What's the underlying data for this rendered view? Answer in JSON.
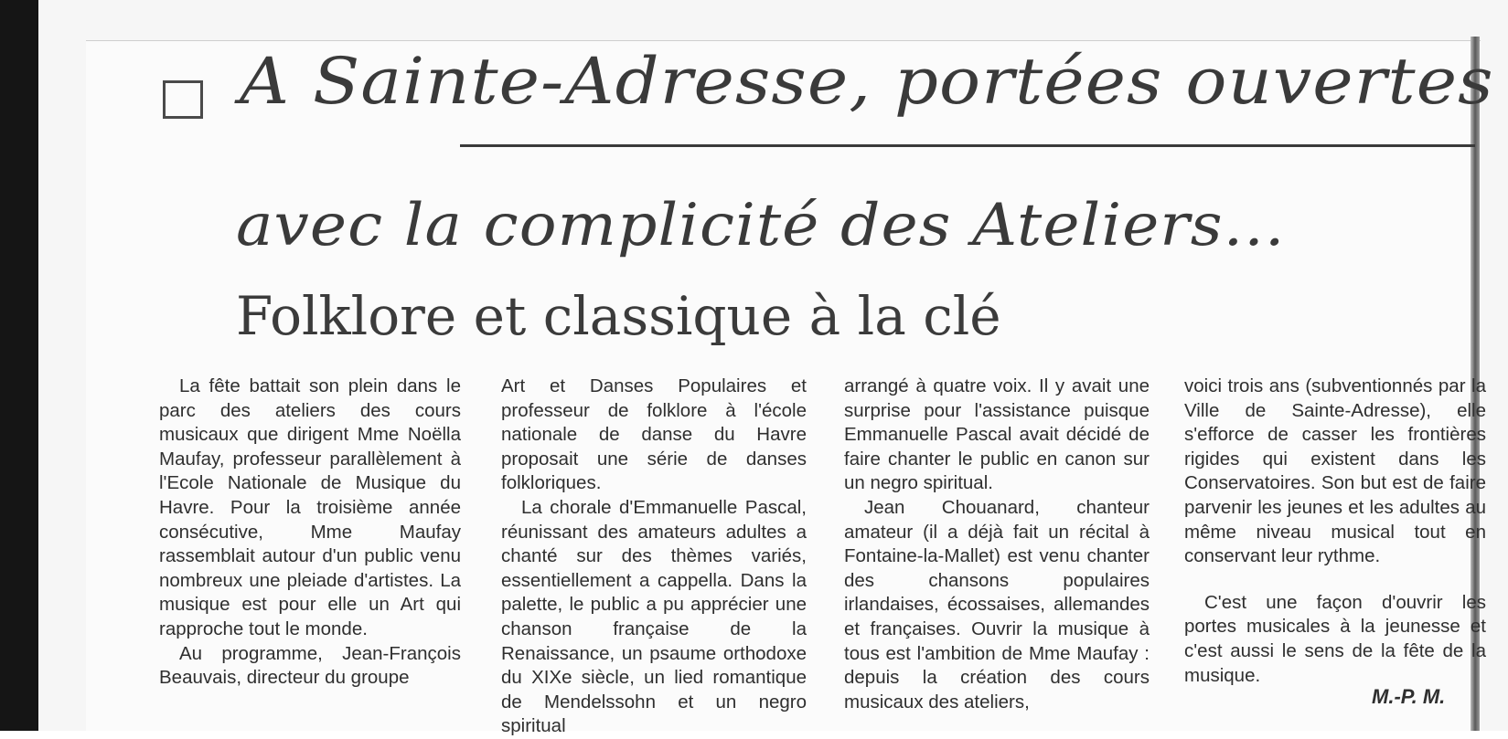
{
  "article": {
    "title_line1": "A Sainte-Adresse, portées ouvertes",
    "title_line2": "avec la complicité des Ateliers...",
    "subtitle": "Folklore et classique à la clé",
    "col1": {
      "p1": "La fête battait son plein dans le parc des ateliers des cours musicaux que dirigent Mme Noëlla Maufay, professeur parallèlement à l'Ecole Nationale de Musique du Havre. Pour la troisième année consécutive, Mme Maufay rassemblait autour d'un public venu nombreux une pleiade d'artistes. La musique est pour elle un Art qui rapproche tout le monde.",
      "p2": "Au programme, Jean-François Beauvais, directeur du groupe"
    },
    "col2": {
      "p1": "Art et Danses Populaires et professeur de folklore à l'école nationale de danse du Havre proposait une série de danses folkloriques.",
      "p2": "La chorale d'Emmanuelle Pascal, réunissant des amateurs adultes a chanté sur des thèmes variés, essentiellement a cappella. Dans la palette, le public a pu apprécier une chanson française de la Renaissance, un psaume orthodoxe du XIXe siècle, un lied romantique de Mendelssohn et un negro spiritual"
    },
    "col3": {
      "p1": "arrangé à quatre voix. Il y avait une surprise pour l'assistance puisque Emmanuelle Pascal avait décidé de faire chanter le public en canon sur un negro spiritual.",
      "p2": "Jean Chouanard, chanteur amateur (il a déjà fait un récital à Fontaine-la-Mallet) est venu chanter des chansons populaires irlandaises, écossaises, allemandes et françaises. Ouvrir la musique à tous est l'ambition de Mme Maufay : depuis la création des cours musicaux des ateliers,"
    },
    "col4": {
      "p1": "voici trois ans (subventionnés par la Ville de Sainte-Adresse), elle s'efforce de casser les frontières rigides qui existent dans les Conservatoires. Son but est de faire parvenir les jeunes et les adultes au même niveau musical tout en conservant leur rythme.",
      "p2": "C'est une façon d'ouvrir les portes musicales à la jeunesse et c'est aussi le sens de la fête de la musique."
    },
    "signature": "M.-P. M."
  }
}
